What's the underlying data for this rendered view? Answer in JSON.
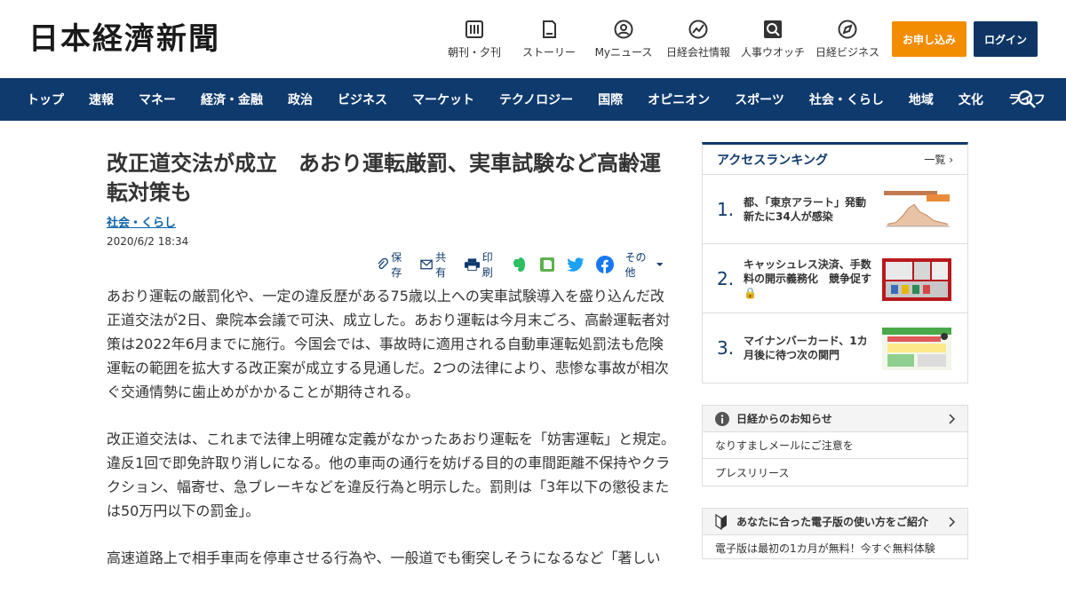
{
  "header": {
    "logo": "日本経濟新聞",
    "quicklinks": [
      {
        "label": "朝刊・夕刊",
        "icon": "newspaper-icon"
      },
      {
        "label": "ストーリー",
        "icon": "book-icon"
      },
      {
        "label": "Myニュース",
        "icon": "person-icon"
      },
      {
        "label": "日経会社情報",
        "icon": "chart-icon"
      },
      {
        "label": "人事ウオッチ",
        "icon": "search-person-icon"
      },
      {
        "label": "日経ビジネス",
        "icon": "compass-icon"
      }
    ],
    "subscribe_label": "お申し込み",
    "login_label": "ログイン",
    "subscribe_color": "#f28c00",
    "login_color": "#0f3565"
  },
  "nav": {
    "items": [
      "トップ",
      "速報",
      "マネー",
      "経済・金融",
      "政治",
      "ビジネス",
      "マーケット",
      "テクノロジー",
      "国際",
      "オピニオン",
      "スポーツ",
      "社会・くらし",
      "地域",
      "文化",
      "ライフ"
    ],
    "color": "#0f3a6e"
  },
  "article": {
    "title": "改正道交法が成立　あおり運転厳罰、実車試験など高齢運転対策も",
    "category": "社会・くらし",
    "date": "2020/6/2 18:34",
    "share": {
      "save": "保存",
      "share": "共有",
      "print": "印刷",
      "other": "その他"
    },
    "paragraphs": [
      "あおり運転の厳罰化や、一定の違反歴がある75歳以上への実車試験導入を盛り込んだ改正道交法が2日、衆院本会議で可決、成立した。あおり運転は今月末ごろ、高齢運転者対策は2022年6月までに施行。今国会では、事故時に適用される自動車運転処罰法も危険運転の範囲を拡大する改正案が成立する見通しだ。2つの法律により、悲惨な事故が相次ぐ交通情勢に歯止めがかかることが期待される。",
      "改正道交法は、これまで法律上明確な定義がなかったあおり運転を「妨害運転」と規定。違反1回で即免許取り消しになる。他の車両の通行を妨げる目的の車間距離不保持やクラクション、幅寄せ、急ブレーキなどを違反行為と明示した。罰則は「3年以下の懲役または50万円以下の罰金」。",
      "高速道路上で相手車両を停車させる行為や、一般道でも衝突しそうになるなど「著しい"
    ]
  },
  "ranking": {
    "title": "アクセスランキング",
    "more": "一覧",
    "items": [
      {
        "rank": "1.",
        "text": "都、「東京アラート」発動　新たに34人が感染"
      },
      {
        "rank": "2.",
        "text": "キャッシュレス決済、手数料の開示義務化　競争促す"
      },
      {
        "rank": "3.",
        "text": "マイナンバーカード、1カ月後に待つ次の関門"
      }
    ]
  },
  "notice": {
    "title": "日経からのお知らせ",
    "items": [
      "なりすましメールにご注意を",
      "プレスリリース"
    ]
  },
  "guide": {
    "title": "あなたに合った電子版の使い方をご紹介",
    "item": "電子版は最初の1カ月が無料！今すぐ無料体験"
  }
}
